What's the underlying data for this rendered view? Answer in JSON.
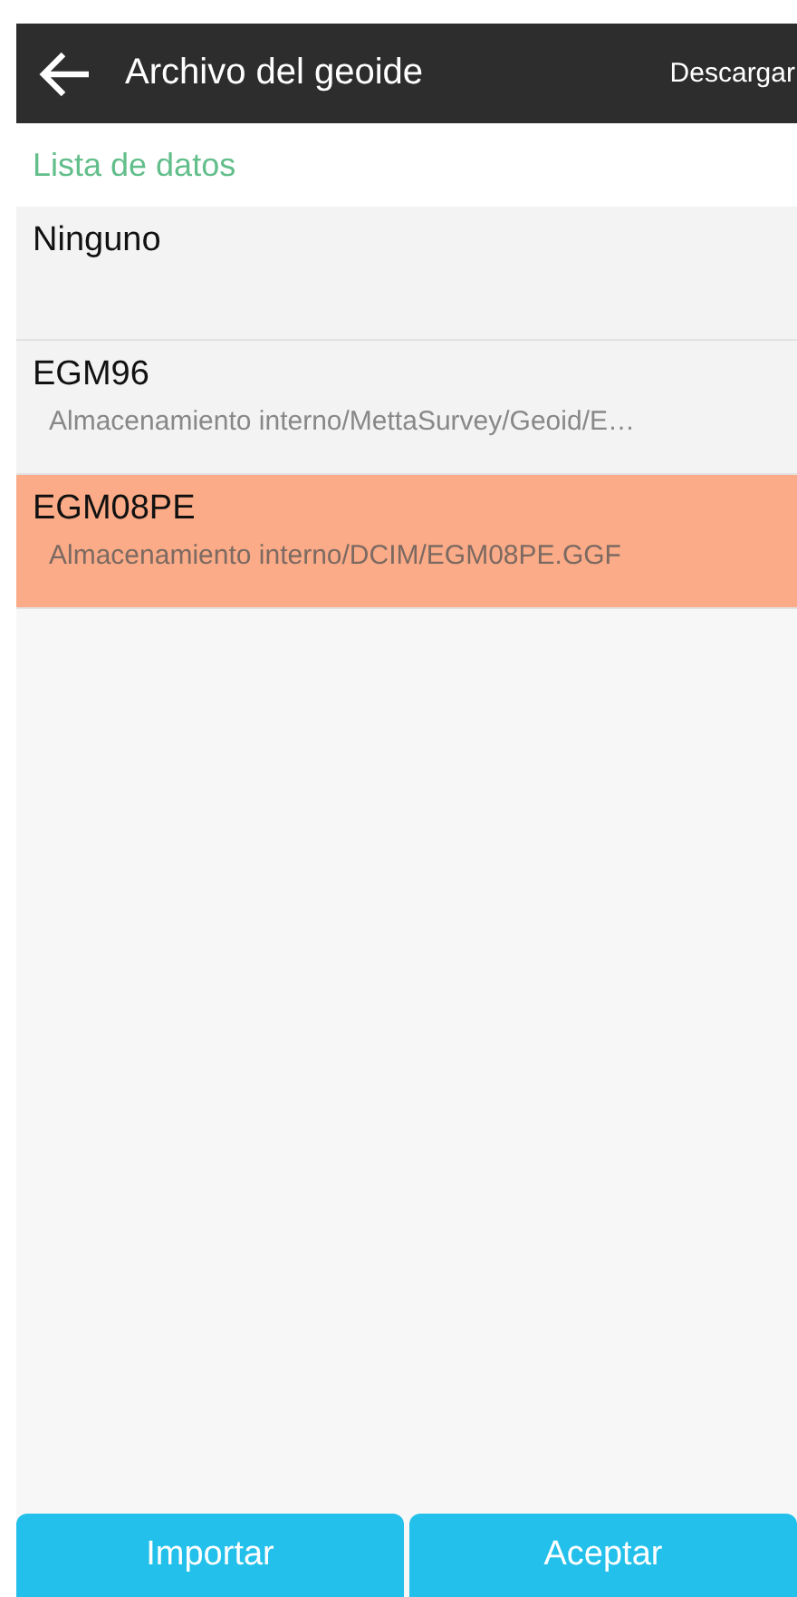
{
  "header": {
    "title": "Archivo del geoide",
    "action": "Descargar"
  },
  "section_label": "Lista de datos",
  "items": [
    {
      "name": "Ninguno",
      "selected": false
    },
    {
      "name": "EGM96",
      "path": "Almacenamiento interno/MettaSurvey/Geoid/E…",
      "selected": false
    },
    {
      "name": "EGM08PE",
      "path": "Almacenamiento interno/DCIM/EGM08PE.GGF",
      "selected": true
    }
  ],
  "buttons": [
    "Importar",
    "Aceptar"
  ]
}
